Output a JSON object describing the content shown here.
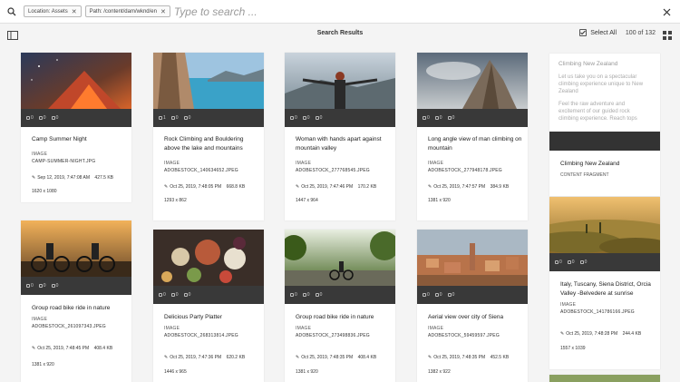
{
  "search": {
    "tags": [
      {
        "label": "Location: Assets"
      },
      {
        "label": "Path: /content/dam/wknd/en"
      }
    ],
    "placeholder": "Type to search ..."
  },
  "toolbar": {
    "title": "Search Results",
    "select_all": "Select All",
    "count": "100 of 132"
  },
  "quickbar": {
    "items": [
      "0",
      "0",
      "0",
      "0"
    ],
    "items_first": [
      "1",
      "0",
      "0",
      "0"
    ]
  },
  "cards": [
    {
      "title": "Camp Summer Night",
      "type": "IMAGE",
      "file": "CAMP-SUMMER-NIGHT.JPG",
      "date": "Sep 12, 2019, 7:47:08 AM",
      "size": "427.5 KB",
      "dims": "1620 x 1080"
    },
    {
      "title": "Rock Climbing and Bouldering above the lake and mountains",
      "type": "IMAGE",
      "file": "ADOBESTOCK_140634652.JPEG",
      "date": "Oct 25, 2019, 7:48:05 PM",
      "size": "668.8 KB",
      "dims": "1293 x 862"
    },
    {
      "title": "Woman with hands apart against mountain valley",
      "type": "IMAGE",
      "file": "ADOBESTOCK_277768545.JPEG",
      "date": "Oct 25, 2019, 7:47:46 PM",
      "size": "170.2 KB",
      "dims": "1447 x 964"
    },
    {
      "title": "Long angle view of man climbing on mountain",
      "type": "IMAGE",
      "file": "ADOBESTOCK_277948178.JPEG",
      "date": "Oct 25, 2019, 7:47:57 PM",
      "size": "384.9 KB",
      "dims": "1381 x 920"
    },
    {
      "title": "Group road bike ride in nature",
      "type": "IMAGE",
      "file": "ADOBESTOCK_261097343.JPEG",
      "date": "Oct 25, 2019, 7:48:45 PM",
      "size": "408.4 KB",
      "dims": "1381 x 920"
    },
    {
      "title": "Delicious Party Platter",
      "type": "IMAGE",
      "file": "ADOBESTOCK_268313814.JPEG",
      "date": "Oct 25, 2019, 7:47:36 PM",
      "size": "620.2 KB",
      "dims": "1446 x 965"
    },
    {
      "title": "Group road bike ride in nature",
      "type": "IMAGE",
      "file": "ADOBESTOCK_273498836.JPEG",
      "date": "Oct 25, 2019, 7:48:35 PM",
      "size": "408.4 KB",
      "dims": "1381 x 920"
    },
    {
      "title": "Aerial view over city of Siena",
      "type": "IMAGE",
      "file": "ADOBESTOCK_59459597.JPEG",
      "date": "Oct 25, 2019, 7:48:35 PM",
      "size": "452.5 KB",
      "dims": "1382 x 922"
    },
    {
      "title": "Italy, Tuscany, Siena District, Orcia Valley -Belvedere at sunrise",
      "type": "IMAGE",
      "file": "ADOBESTOCK_141786166.JPEG",
      "date": "Oct 25, 2019, 7:48:28 PM",
      "size": "244.4 KB",
      "dims": "1557 x 1039"
    }
  ],
  "content_fragment": {
    "preview_heading": "Climbing New Zealand",
    "preview_p1": "Let us take you on a spectacular climbing experience unique to New Zealand",
    "preview_p2": "Feel the raw adventure and excitement of our guided rock climbing experience. Reach tops",
    "title": "Climbing New Zealand",
    "type": "CONTENT FRAGMENT"
  }
}
